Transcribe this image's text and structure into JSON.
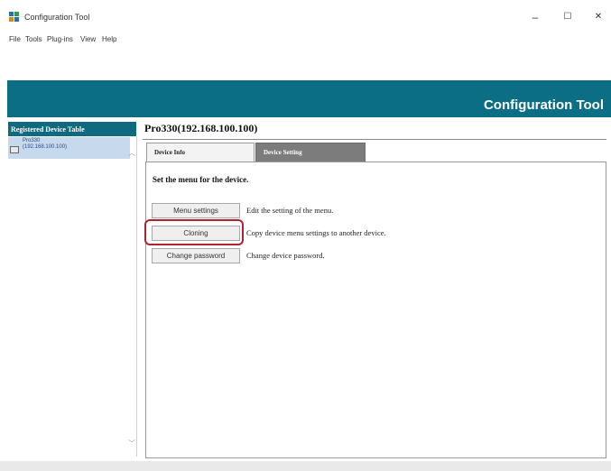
{
  "window": {
    "title": "Configuration Tool",
    "minimize": "–",
    "maximize": "☐",
    "close": "✕"
  },
  "menubar": [
    "File",
    "Tools",
    "Plug-ins",
    "View",
    "Help"
  ],
  "banner": {
    "title": "Configuration Tool",
    "color": "#0c6e85"
  },
  "sidebar": {
    "header": "Registered Device Table",
    "device": {
      "name": "Pro330",
      "ip": "(192.168.100.100)"
    }
  },
  "main": {
    "title": "Pro330(192.168.100.100)",
    "tabs": [
      {
        "label": "Device Info",
        "active": false
      },
      {
        "label": "Device Setting",
        "active": true
      }
    ],
    "section_title": "Set the menu for the device.",
    "actions": [
      {
        "button": "Menu settings",
        "description": "Edit the setting of the menu."
      },
      {
        "button": "Cloning",
        "description": "Copy device menu settings to another device."
      },
      {
        "button": "Change password",
        "description": "Change device password."
      }
    ]
  },
  "highlight_color": "#b0222d"
}
